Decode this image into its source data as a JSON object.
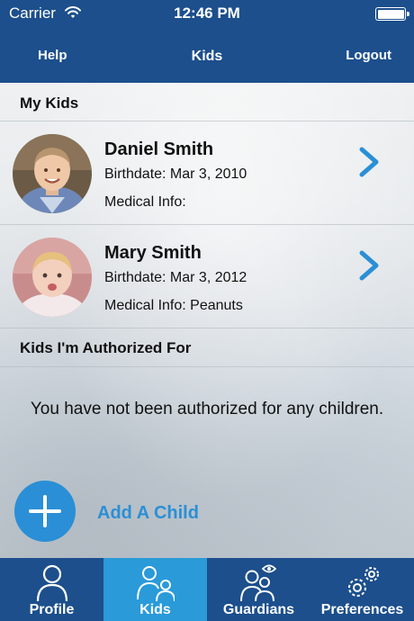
{
  "status_bar": {
    "carrier": "Carrier",
    "time": "12:46 PM"
  },
  "nav": {
    "left": "Help",
    "title": "Kids",
    "right": "Logout"
  },
  "sections": {
    "my_kids": "My Kids",
    "authorized": "Kids I'm Authorized For"
  },
  "kids": [
    {
      "name": "Daniel Smith",
      "birthdate_label": "Birthdate:",
      "birthdate": "Mar 3, 2010",
      "medical_label": "Medical Info:",
      "medical": ""
    },
    {
      "name": "Mary Smith",
      "birthdate_label": "Birthdate:",
      "birthdate": "Mar 3, 2012",
      "medical_label": "Medical Info:",
      "medical": "Peanuts"
    }
  ],
  "kids_text": [
    {
      "birthdate_line": "Birthdate: Mar 3, 2010",
      "medical_line": "Medical Info:"
    },
    {
      "birthdate_line": "Birthdate: Mar 3, 2012",
      "medical_line": "Medical Info:  Peanuts"
    }
  ],
  "empty_message": "You have not been authorized for any children.",
  "add_child": {
    "label": "Add A Child",
    "icon": "plus-icon"
  },
  "tabs": [
    {
      "label": "Profile",
      "icon": "person-icon"
    },
    {
      "label": "Kids",
      "icon": "kids-icon"
    },
    {
      "label": "Guardians",
      "icon": "guardians-eye-icon"
    },
    {
      "label": "Preferences",
      "icon": "gears-icon"
    }
  ],
  "active_tab": "Kids",
  "colors": {
    "nav_bg": "#1c4f8c",
    "accent": "#2a8fd6",
    "active_tab": "#2a9ad8"
  }
}
